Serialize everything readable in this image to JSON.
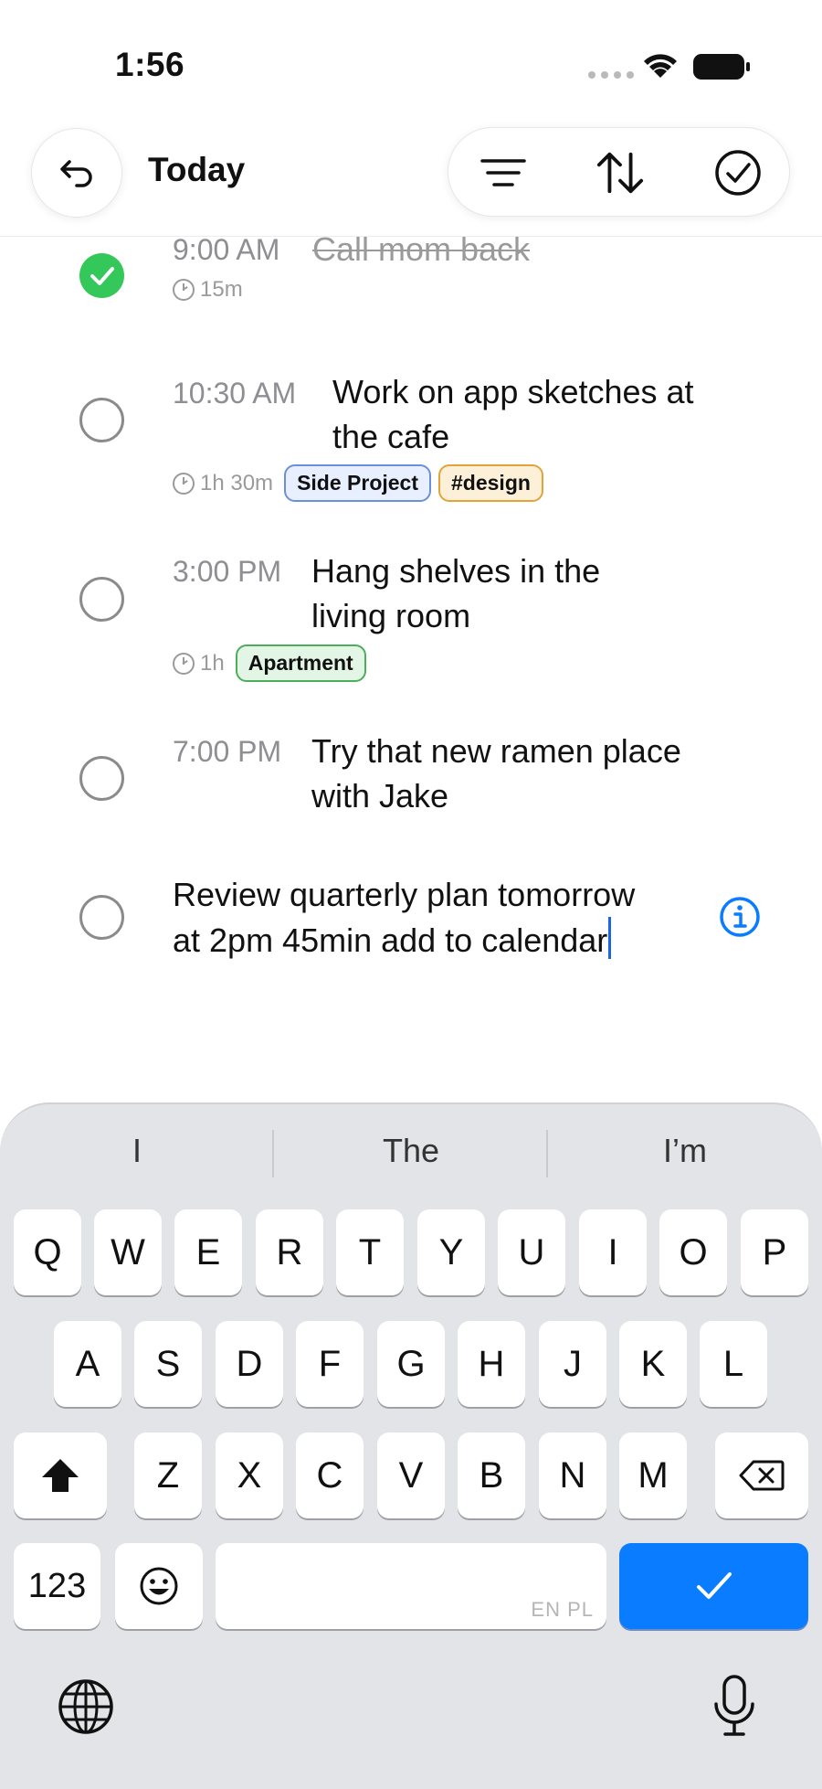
{
  "status": {
    "time": "1:56"
  },
  "header": {
    "title": "Today"
  },
  "tasks": [
    {
      "time": "9:00 AM",
      "title": "Call mom back",
      "completed": true,
      "duration": "15m",
      "tags": []
    },
    {
      "time": "10:30 AM",
      "title_lines": [
        "Work on app sketches at",
        "the cafe"
      ],
      "completed": false,
      "duration": "1h 30m",
      "tags": [
        {
          "label": "Side Project",
          "color": "#6b8fd9"
        },
        {
          "label": "#design",
          "color": "#e2a338"
        }
      ]
    },
    {
      "time": "3:00 PM",
      "title_lines": [
        "Hang shelves in the",
        "living room"
      ],
      "completed": false,
      "duration": "1h",
      "tags": [
        {
          "label": "Apartment",
          "color": "#4cae5a"
        }
      ]
    },
    {
      "time": "7:00 PM",
      "title_lines": [
        "Try that new ramen place",
        "with Jake"
      ],
      "completed": false
    }
  ],
  "new_task": {
    "lines": [
      "Review quarterly plan tomorrow",
      "at 2pm 45min add to calendar"
    ]
  },
  "keyboard": {
    "suggestions": [
      "I",
      "The",
      "I’m"
    ],
    "row1": [
      "Q",
      "W",
      "E",
      "R",
      "T",
      "Y",
      "U",
      "I",
      "O",
      "P"
    ],
    "row2": [
      "A",
      "S",
      "D",
      "F",
      "G",
      "H",
      "J",
      "K",
      "L"
    ],
    "row3": [
      "Z",
      "X",
      "C",
      "V",
      "B",
      "N",
      "M"
    ],
    "numbers_label": "123",
    "space_languages": "EN PL"
  },
  "colors": {
    "accent": "#0a7cff",
    "done": "#34c759"
  }
}
